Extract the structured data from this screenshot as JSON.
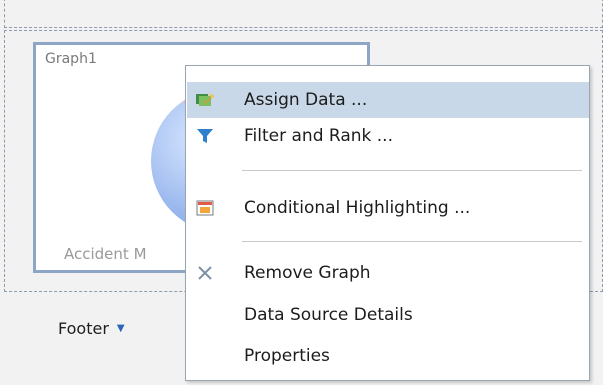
{
  "graph": {
    "title": "Graph1",
    "footer_label": "Accident M"
  },
  "footer_tab": {
    "label": "Footer",
    "icon": "chevron-down-icon"
  },
  "context_menu": {
    "items": [
      {
        "label": "Assign Data ...",
        "icon": "assign-data-icon",
        "highlighted": true
      },
      {
        "label": "Filter and Rank ...",
        "icon": "filter-icon"
      },
      {
        "label": "Conditional Highlighting ...",
        "icon": "conditional-highlighting-icon"
      },
      {
        "label": "Remove Graph",
        "icon": "remove-icon"
      },
      {
        "label": "Data Source Details",
        "icon": ""
      },
      {
        "label": "Properties",
        "icon": ""
      }
    ]
  },
  "colors": {
    "menu_highlight": "#c8d8e8",
    "graph_border": "#8ea6c6",
    "pie_blue": "#a9c3ef",
    "pie_red": "#f5b3b8"
  }
}
